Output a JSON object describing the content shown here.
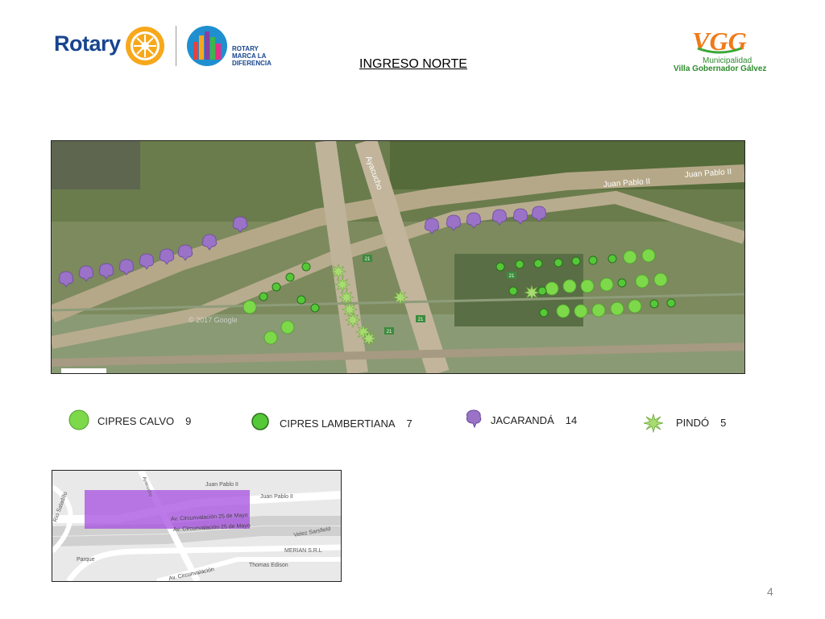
{
  "header": {
    "rotary_label": "Rotary",
    "rotary_marca": [
      "ROTARY",
      "MARCA LA",
      "DIFERENCIA"
    ],
    "page_title": "INGRESO NORTE",
    "municipality_logo": "VGG",
    "municipality_line1": "Municipalidad",
    "municipality_line2": "Villa Gobernador Gálvez"
  },
  "main_map": {
    "street_labels": [
      "Ayacucho",
      "Juan Pablo II",
      "Juan Pablo II"
    ],
    "route_markers": [
      "21",
      "21",
      "21",
      "21"
    ],
    "watermark": "© 2017 Google"
  },
  "legend": [
    {
      "label": "CIPRES CALVO",
      "count": "9",
      "icon": "light-green-circle-icon",
      "color": "#7dd84a"
    },
    {
      "label": "CIPRES LAMBERTIANA",
      "count": "7",
      "icon": "green-circle-icon",
      "color": "#55c838"
    },
    {
      "label": "JACARANDÁ",
      "count": "14",
      "icon": "purple-tree-icon",
      "color": "#9a72c8"
    },
    {
      "label": "PINDÓ",
      "count": "5",
      "icon": "palm-star-icon",
      "color": "#a8dc72"
    }
  ],
  "location_map": {
    "street_labels": [
      "Juan Pablo II",
      "Juan Pablo II",
      "Av. Circunvalación 25 de Mayo",
      "Av. Circunvalación 25 de Mayo",
      "Velez Sarsfield",
      "MERIAN S.R.L",
      "Thomas Edison",
      "Parque",
      "Río Saladillo",
      "Av. Circunvalación",
      "Ayacucho"
    ],
    "highlight_color": "#a64de0"
  },
  "footer": {
    "page_number": "4"
  },
  "colors": {
    "rotary_blue": "#17458f",
    "municipality_green": "#2e8b2e",
    "jacaranda": "#9a72c8",
    "cipres_calvo": "#7dd84a",
    "cipres_lambertiana": "#55c838",
    "pindo": "#a8dc72"
  }
}
